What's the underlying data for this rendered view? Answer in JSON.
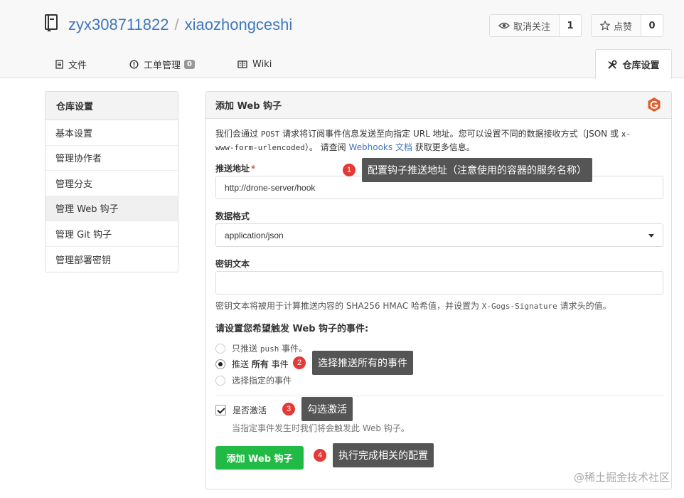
{
  "repo": {
    "owner": "zyx308711822",
    "separator": "/",
    "name": "xiaozhongceshi"
  },
  "actions": {
    "watch_label": "取消关注",
    "watch_count": "1",
    "star_label": "点赞",
    "star_count": "0"
  },
  "tabs": {
    "files": "文件",
    "issues": "工单管理",
    "issues_count": "0",
    "wiki": "Wiki",
    "settings": "仓库设置"
  },
  "sidebar": {
    "header": "仓库设置",
    "items": [
      {
        "label": "基本设置"
      },
      {
        "label": "管理协作者"
      },
      {
        "label": "管理分支"
      },
      {
        "label": "管理 Web 钩子"
      },
      {
        "label": "管理 Git 钩子"
      },
      {
        "label": "管理部署密钥"
      }
    ]
  },
  "form": {
    "title": "添加 Web 钩子",
    "desc_1": "我们会通过 ",
    "desc_post": "POST",
    "desc_2": " 请求将订阅事件信息发送至向指定 URL 地址。您可以设置不同的数据接收方式（JSON 或 ",
    "desc_x": "x-",
    "desc_urlenc": "www-form-urlencoded",
    "desc_3": "）。 请查阅 ",
    "desc_link": "Webhooks 文档",
    "desc_4": " 获取更多信息。",
    "url_label": "推送地址",
    "url_required": "*",
    "url_value": "http://drone-server/hook",
    "format_label": "数据格式",
    "format_value": "application/json",
    "secret_label": "密钥文本",
    "secret_value": "",
    "secret_hint_1": "密钥文本将被用于计算推送内容的 SHA256 HMAC 哈希值，并设置为 ",
    "secret_hint_header": "X-Gogs-Signature",
    "secret_hint_2": " 请求头的值。",
    "events_label": "请设置您希望触发 Web 钩子的事件:",
    "event_push_1": "只推送 ",
    "event_push_2": "push",
    "event_push_3": " 事件。",
    "event_all_1": "推送 ",
    "event_all_2": "所有",
    "event_all_3": " 事件",
    "event_choose": "选择指定的事件",
    "selected_event": "all",
    "active_label": "是否激活",
    "active_checked": true,
    "active_hint": "当指定事件发生时我们将会触发此 Web 钩子。",
    "submit_label": "添加 Web 钩子"
  },
  "annotations": [
    {
      "num": "1",
      "text": "配置钩子推送地址（注意使用的容器的服务名称）"
    },
    {
      "num": "2",
      "text": "选择推送所有的事件"
    },
    {
      "num": "3",
      "text": "勾选激活"
    },
    {
      "num": "4",
      "text": "执行完成相关的配置"
    }
  ],
  "watermark": "@稀土掘金技术社区",
  "colors": {
    "link": "#4078c0",
    "primary_button": "#21ba45",
    "annotation_number": "#e53935",
    "annotation_bubble": "#555555"
  }
}
